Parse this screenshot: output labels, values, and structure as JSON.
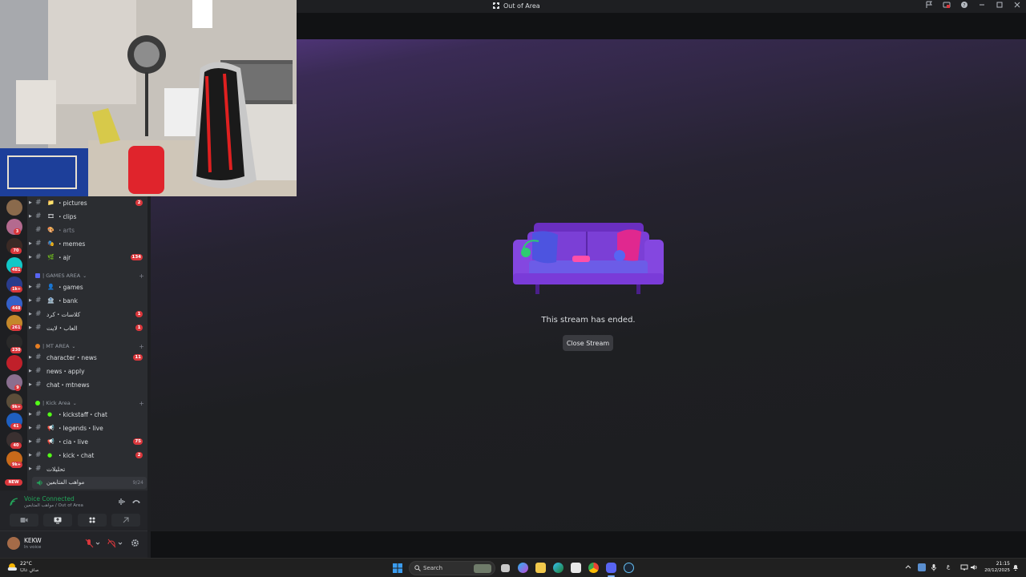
{
  "window": {
    "title": "Out of Area"
  },
  "stream": {
    "ended_text": "This stream has ended.",
    "close_label": "Close Stream"
  },
  "servers": [
    {
      "badge": ""
    },
    {
      "badge": "3"
    },
    {
      "badge": "70"
    },
    {
      "badge": "481"
    },
    {
      "badge": "1k+"
    },
    {
      "badge": "448"
    },
    {
      "badge": "261"
    },
    {
      "badge": "230"
    },
    {
      "badge": ""
    },
    {
      "badge": "9"
    },
    {
      "badge": "9k+"
    },
    {
      "badge": "41"
    },
    {
      "badge": "40"
    },
    {
      "badge": "9k+"
    },
    {
      "badge": "NEW"
    }
  ],
  "channels": {
    "c1": {
      "name": "・pictures",
      "badge": "2"
    },
    "c2": {
      "name": "・clips",
      "badge": ""
    },
    "c3": {
      "name": "・arts",
      "badge": ""
    },
    "c4": {
      "name": "・memes",
      "badge": ""
    },
    "c5": {
      "name": "・ajr",
      "badge": "134"
    },
    "cat1": {
      "label": "| GAMES AREA"
    },
    "c6": {
      "name": "・games",
      "badge": ""
    },
    "c7": {
      "name": "・bank",
      "badge": ""
    },
    "c8": {
      "name": "كلاسات・كرد",
      "badge": "1"
    },
    "c9": {
      "name": "العاب・لايت",
      "badge": "1"
    },
    "cat2": {
      "label": "| MT AREA"
    },
    "c10": {
      "name": "character・news",
      "badge": "11"
    },
    "c11": {
      "name": "news・apply",
      "badge": ""
    },
    "c12": {
      "name": "chat・mtnews",
      "badge": ""
    },
    "cat3": {
      "label": "| Kick Area"
    },
    "c13": {
      "name": "・kickstaff・chat",
      "badge": ""
    },
    "c14": {
      "name": "・legends・live",
      "badge": ""
    },
    "c15": {
      "name": "・cia・live",
      "badge": "75"
    },
    "c16": {
      "name": "・kick・chat",
      "badge": "2"
    },
    "c17": {
      "name": "تحليلات",
      "badge": ""
    }
  },
  "voice_channel": {
    "name": "مواهب المتابعين",
    "count": "9/24"
  },
  "voice_panel": {
    "title": "Voice Connected",
    "subtitle": "مواهب المتابعين / Out of Area"
  },
  "user": {
    "name": "KEKW",
    "status": "In voice"
  },
  "taskbar": {
    "weather_temp": "22°C",
    "weather_desc": "صافٍ غالبًا",
    "search_label": "Search",
    "lang": "ع",
    "time": "21:15",
    "date": "20/12/2025"
  },
  "colors": {
    "accent": "#5865f2",
    "green": "#23a55a",
    "red": "#da373c"
  }
}
